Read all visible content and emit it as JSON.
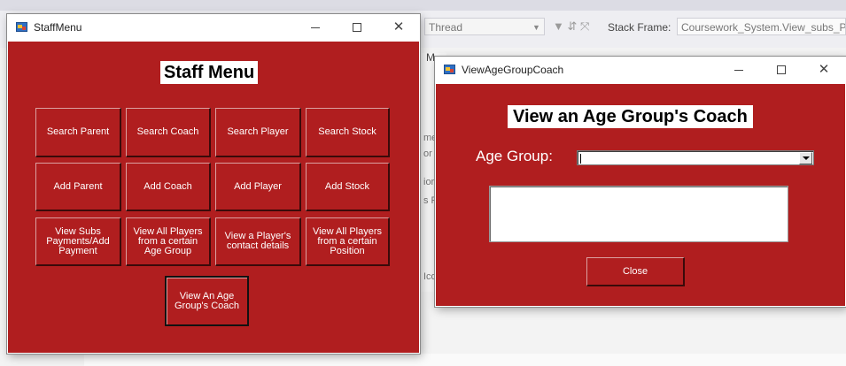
{
  "ide": {
    "toolbar": {
      "thread_label": "Thread",
      "stack_frame_label": "Stack Frame:",
      "stack_frame_value": "Coursework_System.View_subs_Pa"
    },
    "fragments": [
      "me",
      "or",
      "ior",
      "s F",
      "Ico",
      "M"
    ]
  },
  "staff_menu": {
    "title": "StaffMenu",
    "heading": "Staff Menu",
    "buttons": {
      "search_parent": "Search Parent",
      "search_coach": "Search Coach",
      "search_player": "Search Player",
      "search_stock": "Search Stock",
      "add_parent": "Add Parent",
      "add_coach": "Add Coach",
      "add_player": "Add Player",
      "add_stock": "Add Stock",
      "view_subs_1": "View Subs",
      "view_subs_2": "Payments/Add",
      "view_subs_3": "Payment",
      "view_all_age_1": "View All Players",
      "view_all_age_2": "from a certain",
      "view_all_age_3": "Age Group",
      "view_contact_1": "View a Player's",
      "view_contact_2": "contact details",
      "view_all_pos_1": "View All Players",
      "view_all_pos_2": "from a certain",
      "view_all_pos_3": "Position",
      "view_age_coach_1": "View An Age",
      "view_age_coach_2": "Group's Coach"
    }
  },
  "view_age_group_coach": {
    "title": "ViewAgeGroupCoach",
    "heading": "View an Age Group's Coach",
    "age_group_label": "Age Group:",
    "age_group_value": "",
    "result_text": "",
    "close_label": "Close"
  },
  "window_controls": {
    "close_glyph": "✕"
  },
  "colors": {
    "form_background": "#b01e1f",
    "heading_background": "#ffffff"
  }
}
